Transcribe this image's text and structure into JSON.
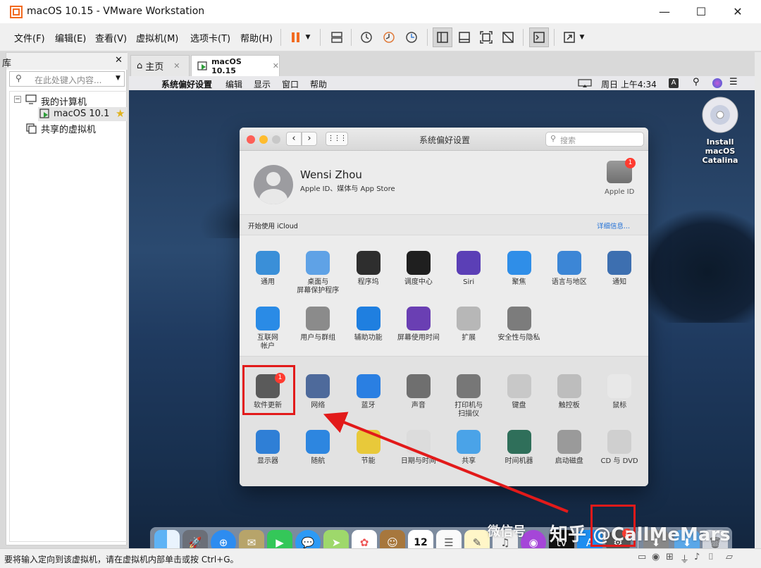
{
  "window": {
    "title": "macOS 10.15 - VMware Workstation",
    "minimize": "—",
    "maximize": "☐",
    "close": "✕"
  },
  "menu": [
    "文件(F)",
    "编辑(E)",
    "查看(V)",
    "虚拟机(M)",
    "选项卡(T)",
    "帮助(H)"
  ],
  "library": {
    "title": "库",
    "close": "✕",
    "search_placeholder": "在此处键入内容...",
    "tree": {
      "my_computer": "我的计算机",
      "vm": "macOS 10.1",
      "shared": "共享的虚拟机"
    }
  },
  "tabs": [
    {
      "label": "主页"
    },
    {
      "label": "macOS 10.15"
    }
  ],
  "mac_menubar": {
    "app": "系统偏好设置",
    "items": [
      "编辑",
      "显示",
      "窗口",
      "帮助"
    ],
    "clock": "周日 上午4:34",
    "input": "A"
  },
  "desktop_icon": {
    "line1": "Install macOS",
    "line2": "Catalina"
  },
  "sysprefs": {
    "title": "系统偏好设置",
    "search_placeholder": "搜索",
    "user_name": "Wensi Zhou",
    "user_sub": "Apple ID、媒体与 App Store",
    "apple_id": "Apple ID",
    "apple_id_badge": "1",
    "icloud_label": "开始使用 iCloud",
    "details": "详细信息...",
    "row1": [
      {
        "l1": "通用",
        "l2": "",
        "icon": "general-icon",
        "color": "#3a8fd8"
      },
      {
        "l1": "桌面与",
        "l2": "屏幕保护程序",
        "icon": "desktop-icon",
        "color": "#5fa2e6"
      },
      {
        "l1": "程序坞",
        "l2": "",
        "icon": "dock-icon",
        "color": "#2e2e2e"
      },
      {
        "l1": "调度中心",
        "l2": "",
        "icon": "mission-control-icon",
        "color": "#1f1f1f"
      },
      {
        "l1": "Siri",
        "l2": "",
        "icon": "siri-icon",
        "color": "#5b3fb6"
      },
      {
        "l1": "聚焦",
        "l2": "",
        "icon": "spotlight-icon",
        "color": "#2f8ee8"
      },
      {
        "l1": "语言与地区",
        "l2": "",
        "icon": "language-icon",
        "color": "#3c86d6"
      },
      {
        "l1": "通知",
        "l2": "",
        "icon": "notifications-icon",
        "color": "#3d6fb0"
      }
    ],
    "row2": [
      {
        "l1": "互联网",
        "l2": "帐户",
        "icon": "internet-accounts-icon",
        "color": "#2a8be6"
      },
      {
        "l1": "用户与群组",
        "l2": "",
        "icon": "users-icon",
        "color": "#8b8b8b"
      },
      {
        "l1": "辅助功能",
        "l2": "",
        "icon": "accessibility-icon",
        "color": "#1f7fe0"
      },
      {
        "l1": "屏幕使用时间",
        "l2": "",
        "icon": "screen-time-icon",
        "color": "#6a3fb3"
      },
      {
        "l1": "扩展",
        "l2": "",
        "icon": "extensions-icon",
        "color": "#b7b7b7"
      },
      {
        "l1": "安全性与隐私",
        "l2": "",
        "icon": "security-icon",
        "color": "#7c7c7c"
      }
    ],
    "row3": [
      {
        "l1": "软件更新",
        "l2": "",
        "icon": "software-update-icon",
        "color": "#5a5a5a"
      },
      {
        "l1": "网络",
        "l2": "",
        "icon": "network-icon",
        "color": "#4e6a9b"
      },
      {
        "l1": "蓝牙",
        "l2": "",
        "icon": "bluetooth-icon",
        "color": "#2a7fe2"
      },
      {
        "l1": "声音",
        "l2": "",
        "icon": "sound-icon",
        "color": "#6f6f6f"
      },
      {
        "l1": "打印机与",
        "l2": "扫描仪",
        "icon": "printer-icon",
        "color": "#777777"
      },
      {
        "l1": "键盘",
        "l2": "",
        "icon": "keyboard-icon",
        "color": "#c8c8c8"
      },
      {
        "l1": "触控板",
        "l2": "",
        "icon": "trackpad-icon",
        "color": "#bdbdbd"
      },
      {
        "l1": "鼠标",
        "l2": "",
        "icon": "mouse-icon",
        "color": "#e8e8e8"
      }
    ],
    "row4": [
      {
        "l1": "显示器",
        "l2": "",
        "icon": "display-icon",
        "color": "#2f7fd6"
      },
      {
        "l1": "随航",
        "l2": "",
        "icon": "sidecar-icon",
        "color": "#2d86e0"
      },
      {
        "l1": "节能",
        "l2": "",
        "icon": "energy-icon",
        "color": "#e8c93a"
      },
      {
        "l1": "日期与时间",
        "l2": "",
        "icon": "clock-icon",
        "color": "#dcdcdc"
      },
      {
        "l1": "共享",
        "l2": "",
        "icon": "sharing-icon",
        "color": "#4aa3e8"
      },
      {
        "l1": "时间机器",
        "l2": "",
        "icon": "time-machine-icon",
        "color": "#2f6f5a"
      },
      {
        "l1": "启动磁盘",
        "l2": "",
        "icon": "startup-disk-icon",
        "color": "#9a9a9a"
      },
      {
        "l1": "CD 与 DVD",
        "l2": "",
        "icon": "cd-dvd-icon",
        "color": "#cfcfcf"
      }
    ],
    "update_badge": "1"
  },
  "dock_badge": "2",
  "dock_calendar": "12",
  "watermark": "知乎 @CallMeMars",
  "watermark_small": "微信号",
  "status": "要将输入定向到该虚拟机，请在虚拟机内部单击或按 Ctrl+G。",
  "colors": {
    "accent_red": "#e21a1a",
    "vmware_pause": "#f26b21"
  }
}
